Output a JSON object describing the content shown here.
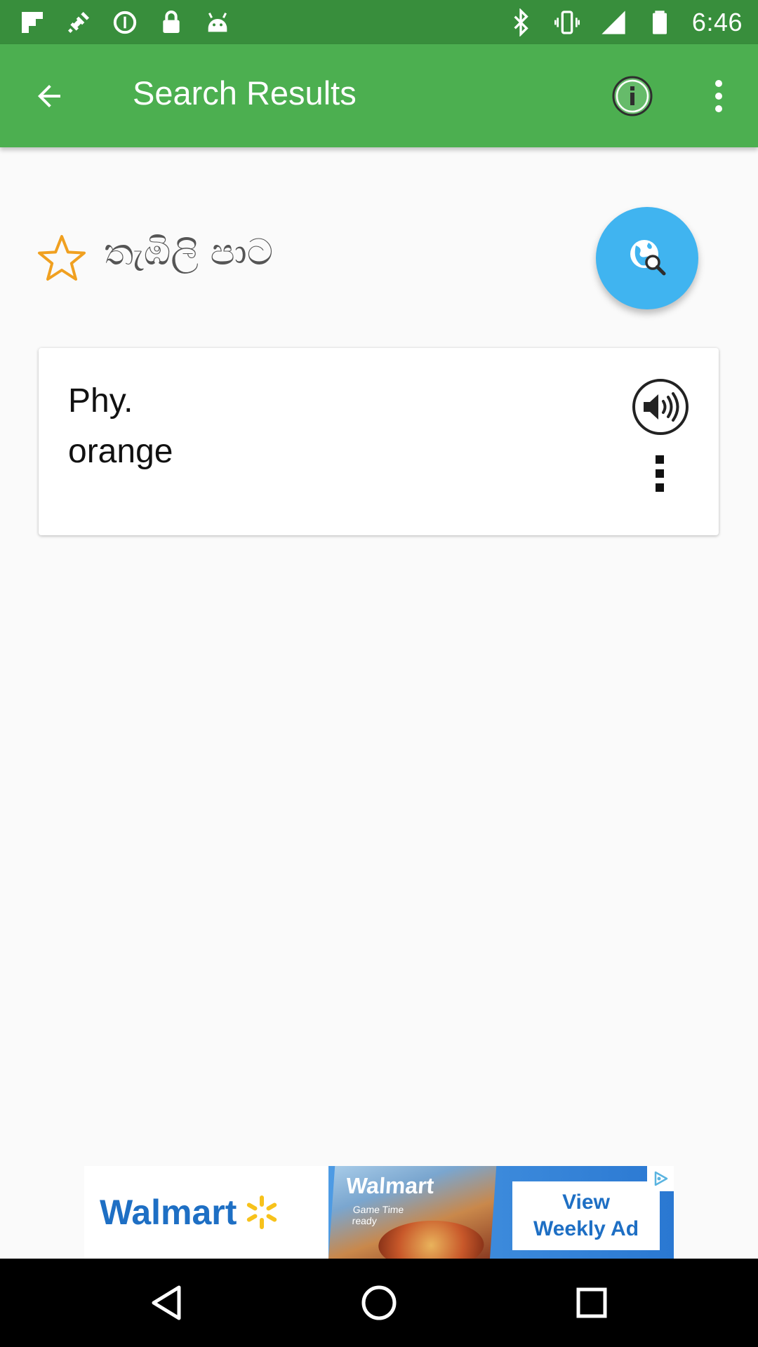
{
  "status_bar": {
    "time": "6:46",
    "left_icons": [
      "flipboard-icon",
      "fake-gps-icon",
      "data-saver-icon",
      "lock-icon",
      "android-icon"
    ],
    "right_icons": [
      "bluetooth-icon",
      "vibrate-icon",
      "signal-icon",
      "battery-icon"
    ]
  },
  "app_bar": {
    "title": "Search Results",
    "background": "#4caf50",
    "status_color": "#388e3c"
  },
  "word": {
    "text": "තැඹිලි පාට",
    "favorite_color": "#f0a020"
  },
  "meaning_card": {
    "part_of_speech": "Phy.",
    "meaning": "orange"
  },
  "fab": {
    "icon": "globe-search-icon",
    "color": "#40b4f0"
  },
  "ad": {
    "brand": "Walmart",
    "photo_brand": "Walmart",
    "photo_subtext": "Game Time ready",
    "cta_line1": "View",
    "cta_line2": "Weekly Ad"
  },
  "nav_bar": {
    "buttons": [
      "back-triangle-icon",
      "home-circle-icon",
      "recents-square-icon"
    ]
  }
}
